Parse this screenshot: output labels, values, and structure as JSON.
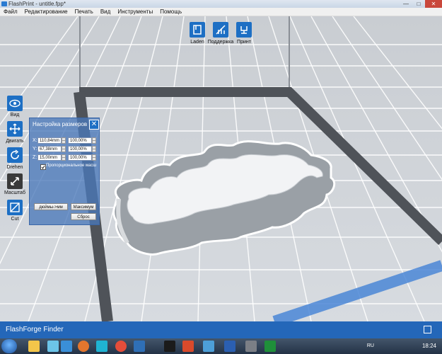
{
  "window": {
    "title": "FlashPrint - untitle.fpp*",
    "buttons": [
      "—",
      "□",
      "✕"
    ]
  },
  "menu": [
    "Файл",
    "Редактирование",
    "Печать",
    "Вид",
    "Инструменты",
    "Помощь"
  ],
  "top_toolbar": [
    {
      "label": "Laden",
      "icon": "load-icon"
    },
    {
      "label": "Поддержка",
      "icon": "support-icon"
    },
    {
      "label": "Принт",
      "icon": "print-icon"
    }
  ],
  "side_toolbar": [
    {
      "label": "Вид",
      "icon": "eye-icon"
    },
    {
      "label": "Двигать",
      "icon": "move-icon"
    },
    {
      "label": "Drehen",
      "icon": "rotate-icon"
    },
    {
      "label": "Масштаб",
      "icon": "scale-icon"
    },
    {
      "label": "Cut",
      "icon": "cut-icon"
    }
  ],
  "scale_panel": {
    "title": "Настройка размеров",
    "close": "✕",
    "rows": [
      {
        "axis": "X:",
        "size": "110,84mm",
        "percent": "100,00%"
      },
      {
        "axis": "Y:",
        "size": "67,38mm",
        "percent": "100,00%"
      },
      {
        "axis": "Z:",
        "size": "15,00mm",
        "percent": "100,00%"
      }
    ],
    "proportional_label": "Пропорциональное масш",
    "proportional_checked": true,
    "inch_to_mm": "дюймы->мм",
    "maximum": "Максимум",
    "reset": "Сброс"
  },
  "status": {
    "brand": "FlashForge Finder"
  },
  "taskbar": {
    "lang": "RU",
    "time": "18:24"
  },
  "colors": {
    "accent": "#1d6fc4",
    "status_bar": "#2467b9",
    "platform_border": "#4f5359",
    "grid": "#ffffff"
  }
}
